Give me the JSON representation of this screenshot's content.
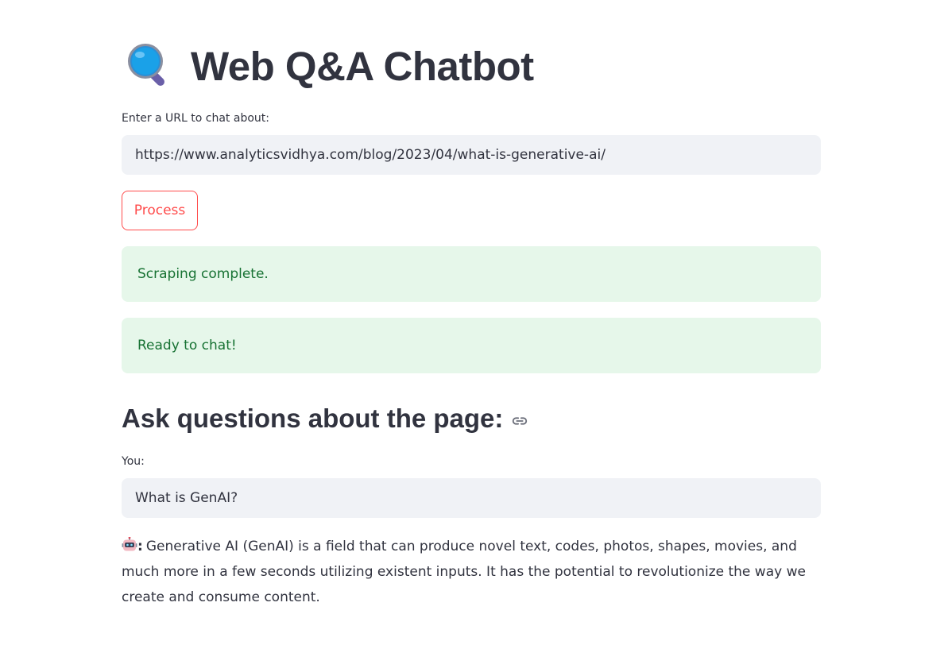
{
  "app": {
    "title": "Web Q&A Chatbot",
    "title_icon": "magnifying-glass-icon"
  },
  "url_form": {
    "label": "Enter a URL to chat about:",
    "value": "https://www.analyticsvidhya.com/blog/2023/04/what-is-generative-ai/",
    "process_label": "Process"
  },
  "status": {
    "scraping": "Scraping complete.",
    "ready": "Ready to chat!"
  },
  "chat": {
    "heading": "Ask questions about the page:",
    "heading_icon": "link-icon",
    "you_label": "You:",
    "question_value": "What is GenAI?",
    "bot_icon": "robot-icon",
    "bot_separator": ":",
    "answer": "Generative AI (GenAI) is a field that can produce novel text, codes, photos, shapes, movies, and much more in a few seconds utilizing existent inputs. It has the potential to revolutionize the way we create and consume content."
  },
  "colors": {
    "accent": "#ff4b4b",
    "input_bg": "#f0f2f6",
    "success_bg": "#e6f7ea",
    "success_text": "#177233",
    "text": "#31333f"
  }
}
